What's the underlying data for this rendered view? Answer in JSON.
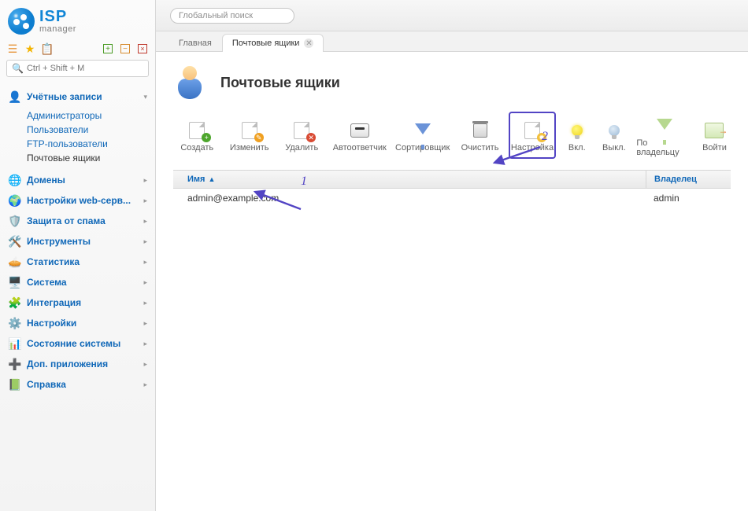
{
  "logo": {
    "l1": "ISP",
    "l2": "manager"
  },
  "side_toolbar": {},
  "search": {
    "placeholder": "Ctrl + Shift + M"
  },
  "global_search": {
    "placeholder": "Глобальный поиск"
  },
  "nav": {
    "accounts": {
      "label": "Учётные записи",
      "arrow": "▾",
      "subs": [
        "Администраторы",
        "Пользователи",
        "FTP-пользователи",
        "Почтовые ящики"
      ]
    },
    "domains": {
      "label": "Домены"
    },
    "web_settings": {
      "label": "Настройки web-серв..."
    },
    "spam": {
      "label": "Защита от спама"
    },
    "tools": {
      "label": "Инструменты"
    },
    "stats": {
      "label": "Статистика"
    },
    "system": {
      "label": "Система"
    },
    "integration": {
      "label": "Интеграция"
    },
    "settings": {
      "label": "Настройки"
    },
    "state": {
      "label": "Состояние системы"
    },
    "addons": {
      "label": "Доп. приложения"
    },
    "help": {
      "label": "Справка"
    }
  },
  "tabs": {
    "main": "Главная",
    "active": "Почтовые ящики"
  },
  "page": {
    "title": "Почтовые ящики"
  },
  "toolbar": {
    "create": "Создать",
    "edit": "Изменить",
    "delete": "Удалить",
    "auto": "Автоответчик",
    "sorter": "Сортировщик",
    "clear": "Очистить",
    "setup": "Настройка",
    "on": "Вкл.",
    "off": "Выкл.",
    "byowner": "По владельцу",
    "login": "Войти"
  },
  "table": {
    "cols": {
      "name": "Имя",
      "owner": "Владелец"
    },
    "rows": [
      {
        "name": "admin@example.com",
        "owner": "admin"
      }
    ]
  },
  "anno": {
    "one": "1",
    "two": "2"
  },
  "colors": {
    "highlight": "#5244c4",
    "link": "#1068b8"
  }
}
